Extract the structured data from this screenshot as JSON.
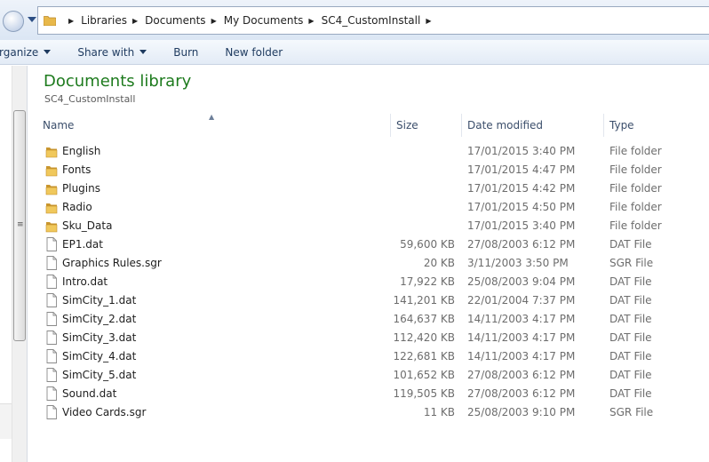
{
  "breadcrumbs": [
    "Libraries",
    "Documents",
    "My Documents",
    "SC4_CustomInstall"
  ],
  "toolbar": {
    "organize_label": "rganize",
    "share_label": "Share with",
    "burn_label": "Burn",
    "new_folder_label": "New folder"
  },
  "library": {
    "title": "Documents library",
    "subtitle": "SC4_CustomInstall"
  },
  "columns": {
    "name": "Name",
    "size": "Size",
    "date": "Date modified",
    "type": "Type"
  },
  "files": [
    {
      "name": "English",
      "size": "",
      "date": "17/01/2015 3:40 PM",
      "type": "File folder",
      "icon": "folder-icon"
    },
    {
      "name": "Fonts",
      "size": "",
      "date": "17/01/2015 4:47 PM",
      "type": "File folder",
      "icon": "folder-icon"
    },
    {
      "name": "Plugins",
      "size": "",
      "date": "17/01/2015 4:42 PM",
      "type": "File folder",
      "icon": "folder-icon"
    },
    {
      "name": "Radio",
      "size": "",
      "date": "17/01/2015 4:50 PM",
      "type": "File folder",
      "icon": "folder-icon"
    },
    {
      "name": "Sku_Data",
      "size": "",
      "date": "17/01/2015 3:40 PM",
      "type": "File folder",
      "icon": "folder-icon"
    },
    {
      "name": "EP1.dat",
      "size": "59,600 KB",
      "date": "27/08/2003 6:12 PM",
      "type": "DAT File",
      "icon": "file-icon"
    },
    {
      "name": "Graphics Rules.sgr",
      "size": "20 KB",
      "date": "3/11/2003 3:50 PM",
      "type": "SGR File",
      "icon": "file-icon"
    },
    {
      "name": "Intro.dat",
      "size": "17,922 KB",
      "date": "25/08/2003 9:04 PM",
      "type": "DAT File",
      "icon": "file-icon"
    },
    {
      "name": "SimCity_1.dat",
      "size": "141,201 KB",
      "date": "22/01/2004 7:37 PM",
      "type": "DAT File",
      "icon": "file-icon"
    },
    {
      "name": "SimCity_2.dat",
      "size": "164,637 KB",
      "date": "14/11/2003 4:17 PM",
      "type": "DAT File",
      "icon": "file-icon"
    },
    {
      "name": "SimCity_3.dat",
      "size": "112,420 KB",
      "date": "14/11/2003 4:17 PM",
      "type": "DAT File",
      "icon": "file-icon"
    },
    {
      "name": "SimCity_4.dat",
      "size": "122,681 KB",
      "date": "14/11/2003 4:17 PM",
      "type": "DAT File",
      "icon": "file-icon"
    },
    {
      "name": "SimCity_5.dat",
      "size": "101,652 KB",
      "date": "27/08/2003 6:12 PM",
      "type": "DAT File",
      "icon": "file-icon"
    },
    {
      "name": "Sound.dat",
      "size": "119,505 KB",
      "date": "27/08/2003 6:12 PM",
      "type": "DAT File",
      "icon": "file-icon"
    },
    {
      "name": "Video Cards.sgr",
      "size": "11 KB",
      "date": "25/08/2003 9:10 PM",
      "type": "SGR File",
      "icon": "file-icon"
    }
  ],
  "colors": {
    "library_title": "#1e7b1e",
    "folder": "#e8b84a",
    "header_text": "#3b4e6b"
  }
}
